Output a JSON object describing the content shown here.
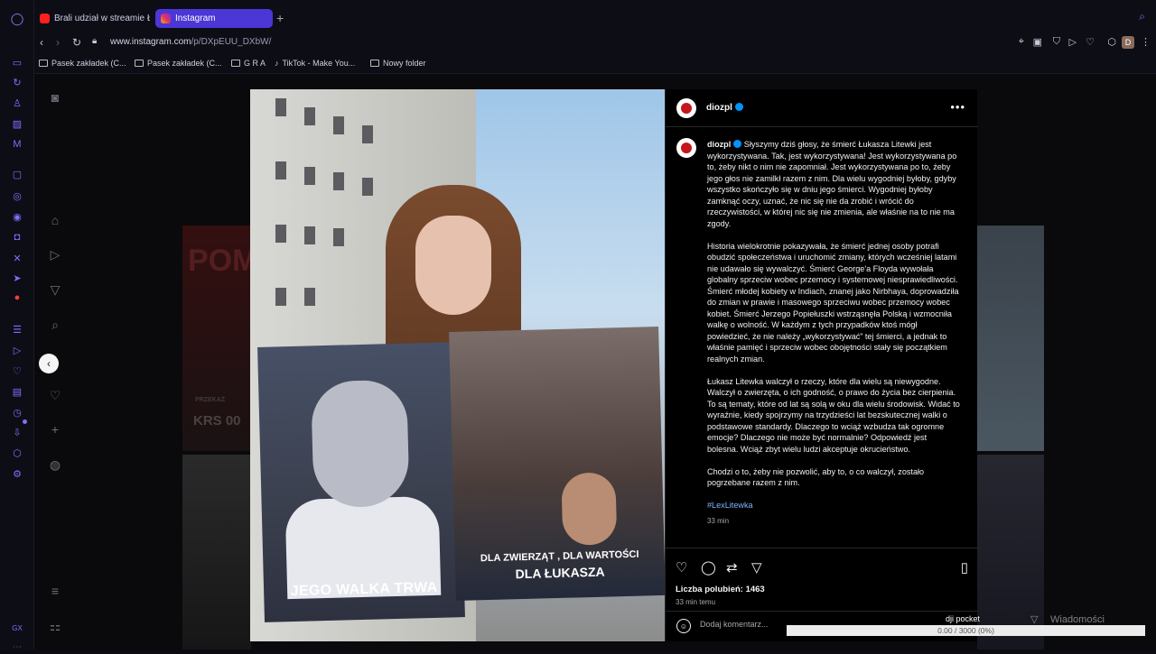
{
  "browser": {
    "tabs": [
      {
        "label": "Brali udział w streamie Łat"
      },
      {
        "label": "Instagram"
      }
    ],
    "new_tab": "+",
    "url_host": "www.instagram.com",
    "url_path": "/p/DXpEUU_DXbW/",
    "profile_initial": "D",
    "bookmarks": [
      {
        "label": "Pasek zakładek (C..."
      },
      {
        "label": "Pasek zakładek (C..."
      },
      {
        "label": "G R A"
      },
      {
        "label": "TikTok - Make You..."
      },
      {
        "label": "Nowy folder"
      }
    ]
  },
  "post": {
    "username": "diozpl",
    "image": {
      "sign_left": "JEGO WALKA TRWA",
      "sign_right_line1": "DLA ZWIERZĄT , DLA WARTOŚCI",
      "sign_right_line2": "DLA ŁUKASZA"
    },
    "caption": {
      "p1": "Słyszymy dziś głosy, że śmierć Łukasza Litewki jest wykorzystywana. Tak, jest wykorzystywana! Jest wykorzystywana po to, żeby nikt o nim nie zapomniał. Jest wykorzystywana po to, żeby jego głos nie zamilkł razem z nim. Dla wielu wygodniej byłoby, gdyby wszystko skończyło się w dniu jego śmierci. Wygodniej byłoby zamknąć oczy, uznać, że nic się nie da zrobić i wrócić do rzeczywistości, w której nic się nie zmienia, ale właśnie na to nie ma zgody.",
      "p2": "Historia wielokrotnie pokazywała, że śmierć jednej osoby potrafi obudzić społeczeństwa i uruchomić zmiany, których wcześniej latami nie udawało się wywalczyć. Śmierć George'a Floyda wywołała globalny sprzeciw wobec przemocy i systemowej niesprawiedliwości. Śmierć młodej kobiety w Indiach, znanej jako Nirbhaya, doprowadziła do zmian w prawie i masowego sprzeciwu wobec przemocy wobec kobiet. Śmierć Jerzego Popiełuszki wstrząsnęła Polską i wzmocniła walkę o wolność. W każdym z tych przypadków ktoś mógł powiedzieć, że nie należy „wykorzystywać” tej śmierci, a jednak to właśnie pamięć i sprzeciw wobec obojętności stały się początkiem realnych zmian.",
      "p3": "Łukasz Litewka walczył o rzeczy, które dla wielu są niewygodne. Walczył o zwierzęta, o ich godność, o prawo do życia bez cierpienia. To są tematy, które od lat są solą w oku dla wielu środowisk. Widać to wyraźnie, kiedy spojrzymy na trzydzieści lat bezskutecznej walki o podstawowe standardy. Dlaczego to wciąż wzbudza tak ogromne emocje? Dlaczego nie może być normalnie? Odpowiedź jest bolesna. Wciąż zbyt wielu ludzi akceptuje okrucieństwo.",
      "p4": "Chodzi o to, żeby nie pozwolić, aby to, o co walczył, zostało pogrzebane razem z nim.",
      "hashtag": "#LexLitewka",
      "time": "33 min"
    },
    "likes": "Liczba polubień: 1463",
    "time": "33 min temu",
    "comment_placeholder": "Dodaj komentarz..."
  },
  "background": {
    "left_text": "POM",
    "left_sub": "KRS 00",
    "left_small": "PRZEKAŻ"
  },
  "overlay": {
    "messages": "Wiadomości",
    "dji_title": "dji pocket",
    "dji_progress_text": "0.00 / 3000 (0%)",
    "dji_progress": 0
  }
}
